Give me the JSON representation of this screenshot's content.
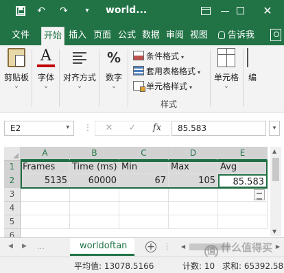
{
  "titlebar": {
    "title": "world...",
    "undo_glyph": "↶",
    "redo_glyph": "↷",
    "dropdown_glyph": "▾",
    "close_glyph": "✕"
  },
  "ribbon_tabs": [
    {
      "label": "文件",
      "active": false
    },
    {
      "label": "开始",
      "active": true
    },
    {
      "label": "插入",
      "active": false
    },
    {
      "label": "页面",
      "active": false
    },
    {
      "label": "公式",
      "active": false
    },
    {
      "label": "数据",
      "active": false
    },
    {
      "label": "审阅",
      "active": false
    },
    {
      "label": "视图",
      "active": false
    }
  ],
  "tell_me": "告诉我",
  "ribbon": {
    "clipboard": "剪贴板",
    "font": "字体",
    "font_glyph": "A",
    "alignment": "对齐方式",
    "number": "数字",
    "number_glyph": "%",
    "conditional_format": "条件格式",
    "format_as_table": "套用表格格式",
    "cell_styles": "单元格样式",
    "styles_group": "样式",
    "cells": "单元格",
    "editing": "编"
  },
  "formula_bar": {
    "name_box": "E2",
    "cancel_glyph": "✕",
    "enter_glyph": "✓",
    "fx_glyph": "fx",
    "value": "85.583"
  },
  "columns": [
    "A",
    "B",
    "C",
    "D",
    "E"
  ],
  "rows": [
    "1",
    "2",
    "3",
    "4",
    "5",
    "6"
  ],
  "cells": {
    "header": [
      "Frames",
      "Time (ms)",
      "Min",
      "Max",
      "Avg"
    ],
    "data": [
      "5135",
      "60000",
      "67",
      "105",
      "85.583"
    ]
  },
  "sheet_tab": "worldoftan",
  "add_sheet_glyph": "+",
  "status": {
    "average": "平均值: 13078.5166",
    "count": "计数: 10",
    "sum": "求和: 65392.583"
  },
  "watermark": {
    "text": "什么值得买",
    "icon_glyph": "值"
  },
  "colors": {
    "accent": "#217346",
    "table_header_fill": "#d9d9d9"
  }
}
